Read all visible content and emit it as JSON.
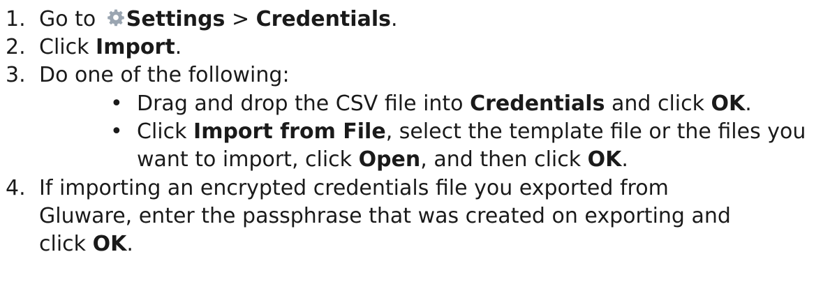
{
  "steps": [
    {
      "number": "1.",
      "parts": {
        "t1": "Go to ",
        "icon": "gear-icon",
        "b1": "Settings",
        "t2": " > ",
        "b2": "Credentials",
        "t3": "."
      }
    },
    {
      "number": "2.",
      "parts": {
        "t1": "Click ",
        "b1": "Import",
        "t2": "."
      }
    },
    {
      "number": "3.",
      "parts": {
        "t1": "Do one of the following:"
      },
      "bullets": [
        {
          "mark": "•",
          "t1": "Drag and drop the CSV file into ",
          "b1": "Credentials",
          "t2": " and click ",
          "b2": "OK",
          "t3": "."
        },
        {
          "mark": "•",
          "t1": "Click ",
          "b1": "Import from File",
          "t2": ", select the template file or the files you",
          "line2_t1": "want to import, click ",
          "line2_b1": "Open",
          "line2_t2": ", and then click ",
          "line2_b2": "OK",
          "line2_t3": "."
        }
      ]
    },
    {
      "number": "4.",
      "lines": [
        "If importing an encrypted credentials file you exported from",
        "Gluware, enter the passphrase that was created on exporting and"
      ],
      "last_line": {
        "t1": "click ",
        "b1": "OK",
        "t2": "."
      }
    }
  ],
  "colors": {
    "text": "#1a1a1a",
    "gear_icon": "#9aa5b1"
  }
}
